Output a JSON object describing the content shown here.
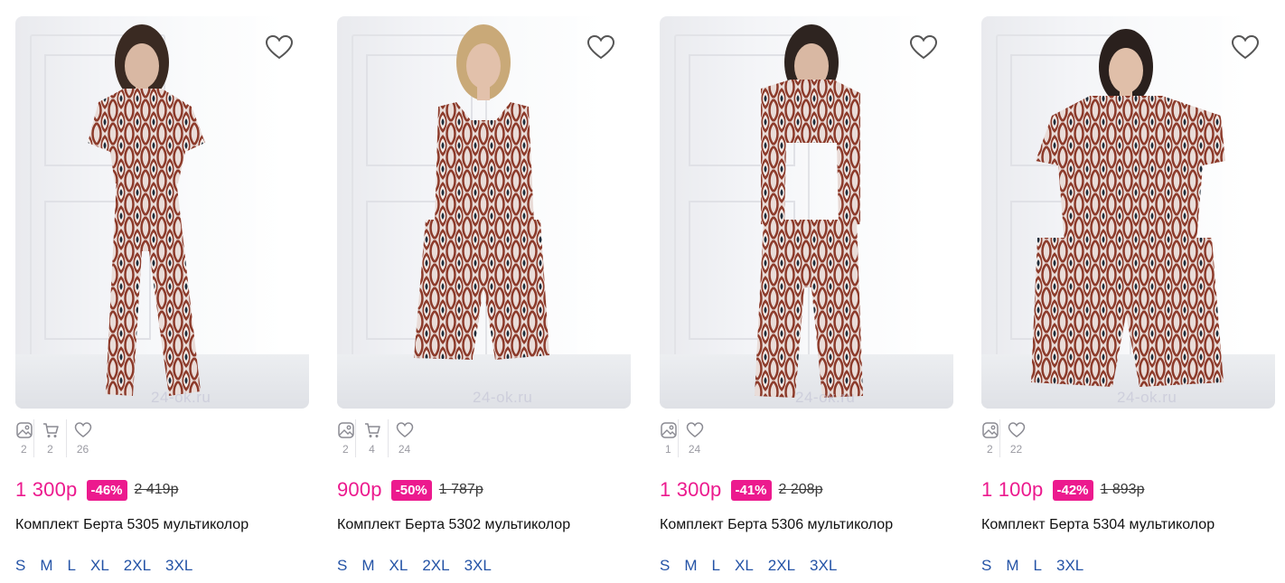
{
  "products": [
    {
      "stats": {
        "photos": "2",
        "in_cart": "2",
        "likes": "26"
      },
      "price": "1 300р",
      "discount": "-46%",
      "old_price": "2 419р",
      "title": "Комплект Берта 5305 мультиколор",
      "sizes": [
        "S",
        "M",
        "L",
        "XL",
        "2XL",
        "3XL"
      ],
      "watermark": "24-ok.ru"
    },
    {
      "stats": {
        "photos": "2",
        "in_cart": "4",
        "likes": "24"
      },
      "price": "900р",
      "discount": "-50%",
      "old_price": "1 787р",
      "title": "Комплект Берта 5302 мультиколор",
      "sizes": [
        "S",
        "M",
        "XL",
        "2XL",
        "3XL"
      ],
      "watermark": "24-ok.ru"
    },
    {
      "stats": {
        "photos": "1",
        "likes": "24"
      },
      "price": "1 300р",
      "discount": "-41%",
      "old_price": "2 208р",
      "title": "Комплект Берта 5306 мультиколор",
      "sizes": [
        "S",
        "M",
        "L",
        "XL",
        "2XL",
        "3XL"
      ],
      "watermark": "24-ok.ru"
    },
    {
      "stats": {
        "photos": "2",
        "likes": "22"
      },
      "price": "1 100р",
      "discount": "-42%",
      "old_price": "1 893р",
      "title": "Комплект Берта 5304 мультиколор",
      "sizes": [
        "S",
        "M",
        "L",
        "3XL"
      ],
      "watermark": "24-ok.ru"
    }
  ],
  "colors": {
    "accent": "#ec1a8e",
    "size_link": "#2453a6",
    "muted": "#9a9aa2"
  },
  "icons": {
    "favorite": "heart-outline-icon",
    "photos": "image-icon",
    "cart": "cart-icon",
    "likes": "heart-icon"
  }
}
